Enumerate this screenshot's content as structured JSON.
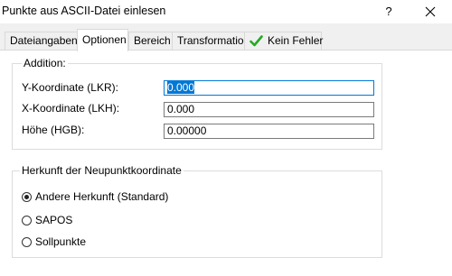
{
  "window": {
    "title": "Punkte aus ASCII-Datei einlesen",
    "help_label": "?",
    "close_icon": "close-icon"
  },
  "tabs": [
    {
      "label": "Dateiangaben",
      "active": false
    },
    {
      "label": "Optionen",
      "active": true
    },
    {
      "label": "Bereich",
      "active": false
    },
    {
      "label": "Transformation",
      "active": false
    },
    {
      "label": "Kein Fehler",
      "active": false,
      "icon": "check-icon",
      "icon_color": "#22aa22"
    }
  ],
  "addition": {
    "legend": "Addition:",
    "fields": [
      {
        "label": "Y-Koordinate (LKR):",
        "value": "0.000",
        "focused": true
      },
      {
        "label": "X-Koordinate (LKH):",
        "value": "0.000",
        "focused": false
      },
      {
        "label": "Höhe (HGB):",
        "value": "0.00000",
        "focused": false
      }
    ]
  },
  "origin": {
    "legend": "Herkunft der Neupunktkoordinate",
    "options": [
      {
        "label": "Andere Herkunft (Standard)",
        "checked": true
      },
      {
        "label": "SAPOS",
        "checked": false
      },
      {
        "label": "Sollpunkte",
        "checked": false
      }
    ]
  },
  "colors": {
    "accent": "#0078d7",
    "check": "#22aa22"
  }
}
